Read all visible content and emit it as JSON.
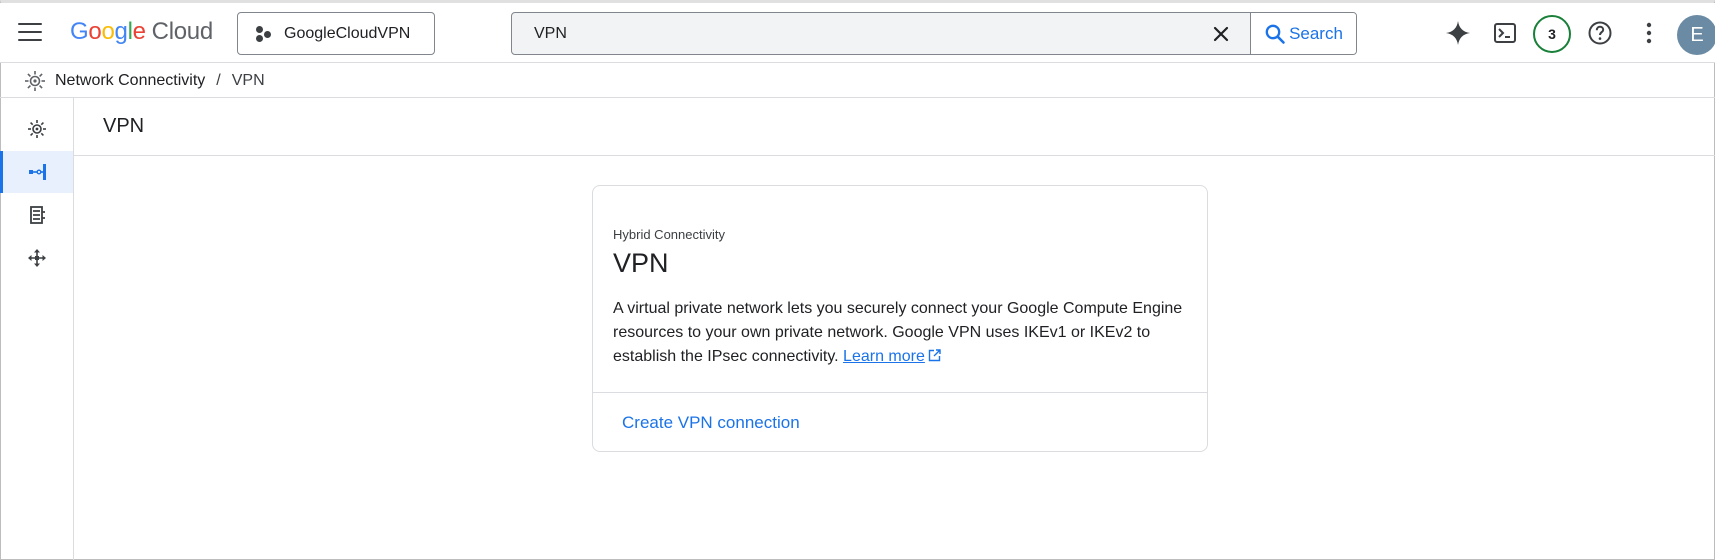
{
  "header": {
    "logo_google": "Google",
    "logo_cloud": "Cloud",
    "project_name": "GoogleCloudVPN",
    "search_value": "VPN",
    "search_button": "Search",
    "notification_count": "3",
    "avatar_initial": "E"
  },
  "breadcrumb": {
    "product": "Network Connectivity",
    "separator": "/",
    "current": "VPN"
  },
  "main": {
    "page_title": "VPN"
  },
  "card": {
    "eyebrow": "Hybrid Connectivity",
    "title": "VPN",
    "description": "A virtual private network lets you securely connect your Google Compute Engine resources to your own private network. Google VPN uses IKEv1 or IKEv2 to establish the IPsec connectivity.",
    "learn_more": "Learn more",
    "action": "Create VPN connection"
  },
  "colors": {
    "accent": "#1a73e8",
    "badge_ring": "#188038",
    "avatar_bg": "#6b8ba4"
  },
  "icons": {
    "menu": "hamburger-menu-icon",
    "project": "project-dots-icon",
    "clear": "close-icon",
    "search": "search-icon",
    "gemini": "sparkle-icon",
    "shell": "cloud-shell-icon",
    "help": "help-icon",
    "more": "more-vert-icon",
    "product": "network-connectivity-icon",
    "external": "external-link-icon"
  }
}
